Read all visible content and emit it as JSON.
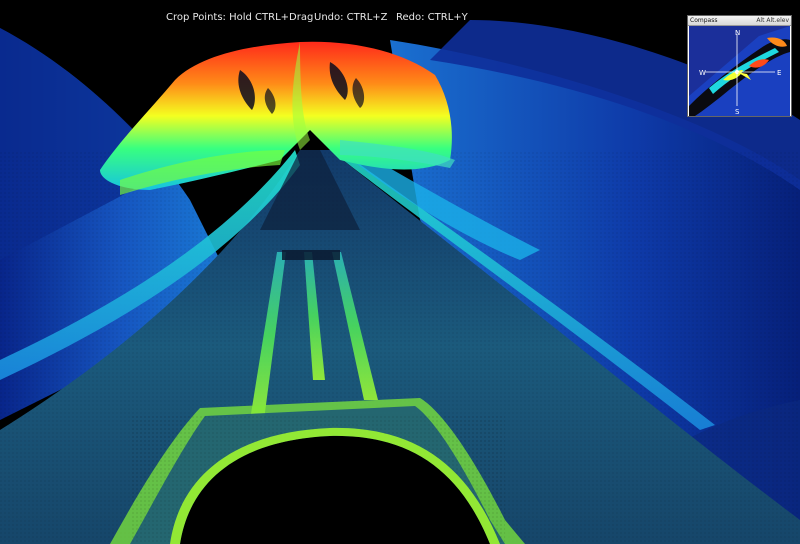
{
  "hints": {
    "crop": "Crop Points: Hold CTRL+Drag",
    "undo": "Undo: CTRL+Z",
    "redo": "Redo: CTRL+Y"
  },
  "compass": {
    "title": "Compass",
    "view_tabs": "Alt  Alt.elev",
    "north": "N",
    "south": "S",
    "east": "E",
    "west": "W"
  },
  "colors": {
    "background": "#000000",
    "seabed_deep": "#0a2a8c",
    "seabed_mid": "#1e7fd6",
    "seabed_shallow": "#29e0c0",
    "ridge_green": "#6dff3a",
    "peak_orange": "#ff7a1a",
    "peak_red": "#ff2a1a",
    "compass_frame": "#ffffff"
  }
}
